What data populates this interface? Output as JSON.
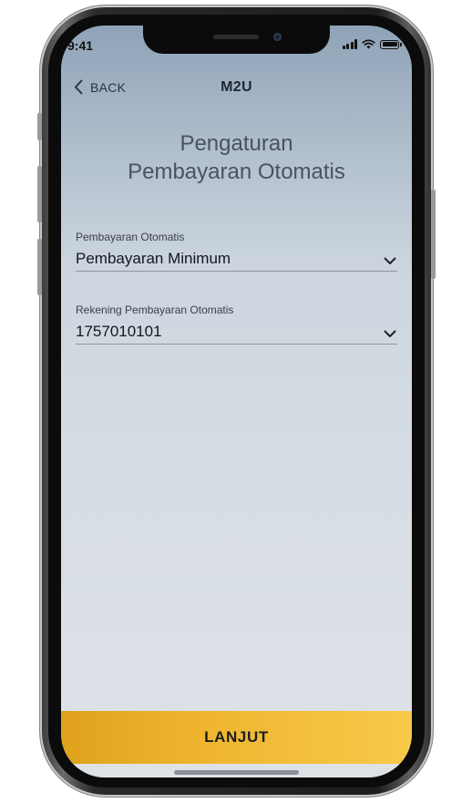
{
  "status_bar": {
    "time": "9:41"
  },
  "nav": {
    "back_label": "BACK",
    "title": "M2U"
  },
  "page": {
    "title_line1": "Pengaturan",
    "title_line2": "Pembayaran Otomatis"
  },
  "form": {
    "fields": [
      {
        "label": "Pembayaran Otomatis",
        "value": "Pembayaran Minimum"
      },
      {
        "label": "Rekening Pembayaran Otomatis",
        "value": "1757010101"
      }
    ]
  },
  "footer": {
    "cta_label": "LANJUT"
  },
  "colors": {
    "accent": "#f0b330",
    "screen_top": "#8fa3b8",
    "screen_bottom": "#dde2e7"
  }
}
